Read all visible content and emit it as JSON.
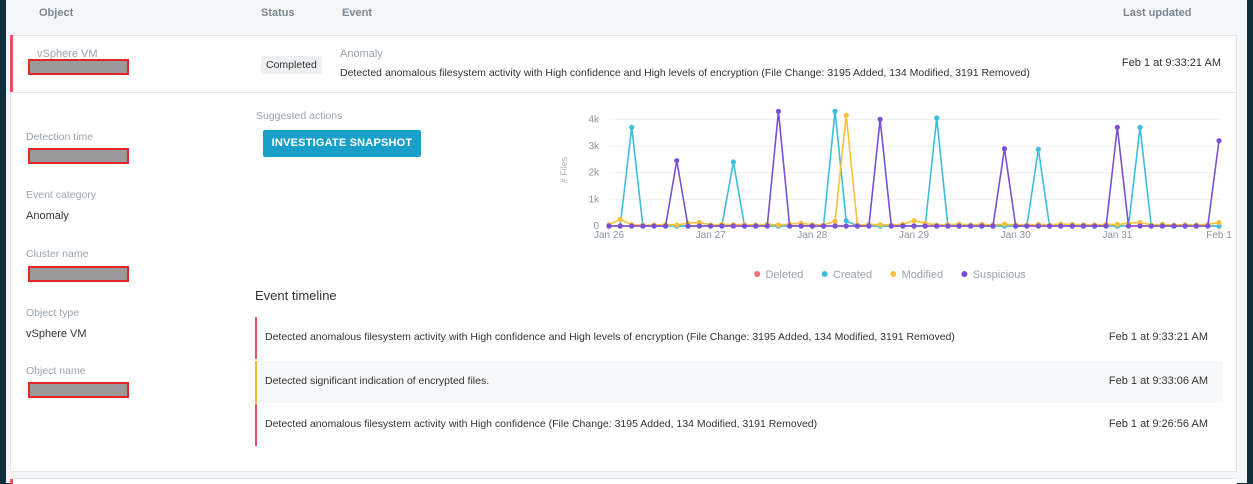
{
  "header": {
    "object": "Object",
    "status": "Status",
    "event": "Event",
    "last_updated": "Last updated"
  },
  "event": {
    "object_type": "vSphere VM",
    "status": "Completed",
    "category": "Anomaly",
    "description": "Detected anomalous filesystem activity with High confidence and High levels of encryption (File Change: 3195 Added, 134 Modified, 3191 Removed)",
    "time": "Feb 1 at 9:33:21 AM"
  },
  "details": {
    "detection_time_label": "Detection time",
    "event_category_label": "Event category",
    "event_category_value": "Anomaly",
    "cluster_name_label": "Cluster name",
    "object_type_label": "Object type",
    "object_type_value": "vSphere VM",
    "object_name_label": "Object name"
  },
  "actions": {
    "label": "Suggested actions",
    "investigate_button": "INVESTIGATE SNAPSHOT"
  },
  "colors": {
    "deleted": "#f06e7c",
    "created": "#3cbfdd",
    "modified": "#f7c23a",
    "suspicious": "#7b4fd6",
    "accent": "#1a9fc9",
    "severity_high": "#e8525f",
    "severity_medium": "#f7b72e"
  },
  "chart_data": {
    "type": "line",
    "ylabel": "# Files",
    "ylim": [
      0,
      4200
    ],
    "yticks": [
      "0",
      "1k",
      "2k",
      "3k",
      "4k"
    ],
    "xticks": [
      "Jan 26",
      "Jan 27",
      "Jan 28",
      "Jan 29",
      "Jan 30",
      "Jan 31",
      "Feb 1"
    ],
    "x": [
      0,
      0.33,
      0.67,
      1,
      1.33,
      1.67,
      2,
      2.33,
      2.67,
      3,
      3.33,
      3.67,
      4,
      4.33,
      4.67,
      5,
      5.33,
      5.67,
      6,
      6.33,
      6.67,
      7,
      7.33,
      7.67,
      8,
      8.33,
      8.67,
      9,
      9.33,
      9.67,
      10,
      10.33,
      10.67,
      11,
      11.33,
      11.67,
      12,
      12.33,
      12.67,
      13,
      13.33,
      13.67,
      14,
      14.33,
      14.67,
      15,
      15.33,
      15.67,
      16,
      16.33,
      16.67,
      17,
      17.33,
      17.67,
      18
    ],
    "series": [
      {
        "name": "Deleted",
        "values": [
          0,
          0,
          0,
          0,
          0,
          0,
          0,
          0,
          0,
          0,
          0,
          0,
          0,
          0,
          0,
          0,
          0,
          0,
          0,
          0,
          0,
          0,
          0,
          0,
          0,
          0,
          0,
          0,
          0,
          0,
          0,
          0,
          0,
          0,
          0,
          0,
          0,
          0,
          0,
          0,
          0,
          0,
          0,
          0,
          0,
          0,
          0,
          0,
          0,
          0,
          0,
          0,
          0,
          0,
          0
        ]
      },
      {
        "name": "Created",
        "values": [
          0,
          0,
          3700,
          0,
          0,
          0,
          0,
          0,
          0,
          0,
          0,
          2400,
          0,
          0,
          0,
          0,
          0,
          0,
          0,
          0,
          4300,
          200,
          0,
          0,
          0,
          0,
          0,
          0,
          0,
          4050,
          0,
          0,
          0,
          0,
          0,
          0,
          0,
          0,
          2880,
          0,
          0,
          0,
          0,
          0,
          0,
          0,
          0,
          3700,
          0,
          0,
          0,
          0,
          0,
          0,
          0
        ]
      },
      {
        "name": "Modified",
        "values": [
          50,
          250,
          50,
          30,
          40,
          50,
          40,
          100,
          130,
          40,
          60,
          50,
          50,
          40,
          60,
          40,
          70,
          100,
          50,
          40,
          180,
          4150,
          40,
          60,
          50,
          40,
          60,
          200,
          100,
          40,
          50,
          70,
          40,
          60,
          40,
          70,
          40,
          40,
          60,
          40,
          70,
          60,
          50,
          40,
          60,
          60,
          100,
          130,
          40,
          60,
          40,
          50,
          40,
          60,
          130
        ]
      },
      {
        "name": "Suspicious",
        "values": [
          0,
          0,
          0,
          0,
          0,
          0,
          2450,
          0,
          0,
          0,
          0,
          0,
          0,
          0,
          0,
          4300,
          0,
          0,
          0,
          0,
          0,
          0,
          0,
          0,
          4000,
          0,
          0,
          0,
          0,
          0,
          0,
          0,
          0,
          0,
          0,
          2900,
          0,
          0,
          0,
          0,
          0,
          0,
          0,
          0,
          0,
          3700,
          0,
          0,
          0,
          0,
          0,
          0,
          0,
          0,
          3200
        ]
      }
    ]
  },
  "timeline": {
    "title": "Event timeline",
    "rows": [
      {
        "text": "Detected anomalous filesystem activity with High confidence and High levels of encryption (File Change: 3195 Added, 134 Modified, 3191 Removed)",
        "time": "Feb 1 at 9:33:21 AM",
        "severity": "high"
      },
      {
        "text": "Detected significant indication of encrypted files.",
        "time": "Feb 1 at 9:33:06 AM",
        "severity": "medium"
      },
      {
        "text": "Detected anomalous filesystem activity with High confidence (File Change: 3195 Added, 134 Modified, 3191 Removed)",
        "time": "Feb 1 at 9:26:56 AM",
        "severity": "high"
      }
    ]
  }
}
